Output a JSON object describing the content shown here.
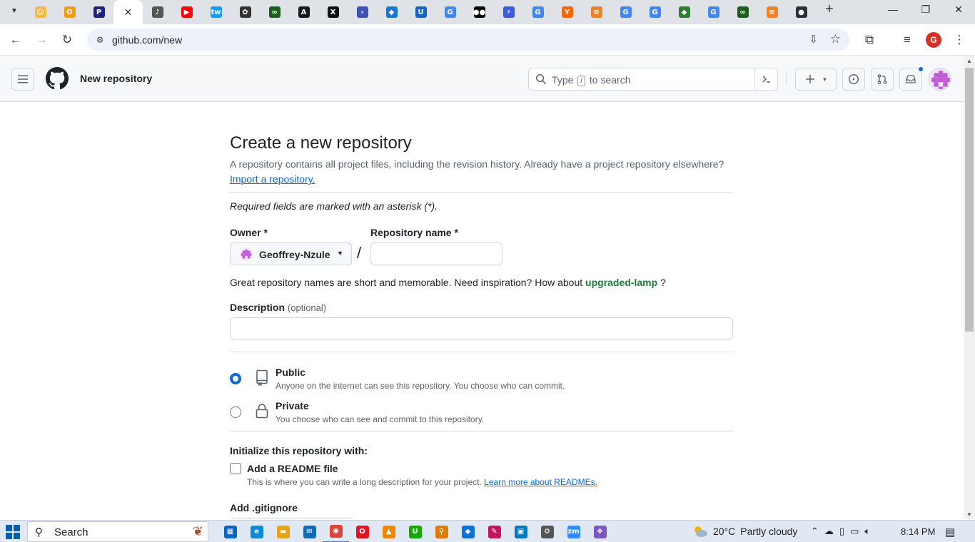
{
  "browser": {
    "url": "github.com/new",
    "pinned_tabs": [
      {
        "name": "tab-emoji",
        "glyph": "☺",
        "color": "#f4b942"
      },
      {
        "name": "tab-orange-badge",
        "glyph": "✪",
        "color": "#f39c12"
      },
      {
        "name": "tab-p-logo",
        "glyph": "P",
        "color": "#1a237e"
      },
      {
        "name": "tab-github-active",
        "glyph": "",
        "color": "#ffffff"
      },
      {
        "name": "tab-audio",
        "glyph": "♪",
        "color": "#555555"
      },
      {
        "name": "tab-youtube",
        "glyph": "▶",
        "color": "#ff0000"
      },
      {
        "name": "tab-tw",
        "glyph": "tw",
        "color": "#1d9bf0"
      },
      {
        "name": "tab-openai",
        "glyph": "✿",
        "color": "#333333"
      },
      {
        "name": "tab-infinity",
        "glyph": "∞",
        "color": "#1b5e20"
      },
      {
        "name": "tab-anthropic",
        "glyph": "A",
        "color": "#191919"
      },
      {
        "name": "tab-x",
        "glyph": "X",
        "color": "#111111"
      },
      {
        "name": "tab-terminal",
        "glyph": "›",
        "color": "#3f51b5"
      },
      {
        "name": "tab-vscode",
        "glyph": "◆",
        "color": "#1976d2"
      },
      {
        "name": "tab-upwork",
        "glyph": "U",
        "color": "#1565c0"
      },
      {
        "name": "tab-google-1",
        "glyph": "G",
        "color": "#4285f4"
      },
      {
        "name": "tab-medium",
        "glyph": "●●",
        "color": "#000000"
      },
      {
        "name": "tab-bolt",
        "glyph": "⚡",
        "color": "#3b5bdb"
      },
      {
        "name": "tab-google-2",
        "glyph": "G",
        "color": "#4285f4"
      },
      {
        "name": "tab-ycombinator",
        "glyph": "Y",
        "color": "#ff6600"
      },
      {
        "name": "tab-stackoverflow-1",
        "glyph": "≡",
        "color": "#f48024"
      },
      {
        "name": "tab-google-3",
        "glyph": "G",
        "color": "#4285f4"
      },
      {
        "name": "tab-google-4",
        "glyph": "G",
        "color": "#4285f4"
      },
      {
        "name": "tab-hashnode",
        "glyph": "◆",
        "color": "#2e7d32"
      },
      {
        "name": "tab-google-5",
        "glyph": "G",
        "color": "#4285f4"
      },
      {
        "name": "tab-infinity-2",
        "glyph": "∞",
        "color": "#1b5e20"
      },
      {
        "name": "tab-stackoverflow-2",
        "glyph": "≡",
        "color": "#f48024"
      },
      {
        "name": "tab-dark-circle",
        "glyph": "●",
        "color": "#263238"
      }
    ],
    "profile_initial": "G"
  },
  "header": {
    "title": "New repository",
    "search_prefix": "Type",
    "search_key": "/",
    "search_suffix": "to search"
  },
  "form": {
    "title": "Create a new repository",
    "subtitle": "A repository contains all project files, including the revision history. Already have a project repository elsewhere?",
    "import_link": "Import a repository.",
    "required_note": "Required fields are marked with an asterisk (*).",
    "owner_label": "Owner *",
    "owner_value": "Geoffrey-Nzule",
    "repo_name_label": "Repository name *",
    "repo_name_value": "",
    "hint_prefix": "Great repository names are short and memorable. Need inspiration? How about",
    "hint_suggestion": "upgraded-lamp",
    "hint_suffix": "?",
    "description_label": "Description",
    "description_optional": "(optional)",
    "description_value": "",
    "visibility": [
      {
        "title": "Public",
        "desc": "Anyone on the internet can see this repository. You choose who can commit.",
        "checked": true
      },
      {
        "title": "Private",
        "desc": "You choose who can see and commit to this repository.",
        "checked": false
      }
    ],
    "init_label": "Initialize this repository with:",
    "readme_label": "Add a README file",
    "readme_checked": false,
    "readme_desc": "This is where you can write a long description for your project.",
    "readme_link": "Learn more about READMEs.",
    "gitignore_label": "Add .gitignore"
  },
  "taskbar": {
    "search_placeholder": "Search",
    "apps": [
      {
        "name": "taskbar-app-store",
        "glyph": "▦",
        "color": "#0a64c8"
      },
      {
        "name": "taskbar-app-edge",
        "glyph": "e",
        "color": "#0f8bd6"
      },
      {
        "name": "taskbar-app-file-explorer",
        "glyph": "▬",
        "color": "#e8a317"
      },
      {
        "name": "taskbar-app-mail",
        "glyph": "✉",
        "color": "#0f6cbd"
      },
      {
        "name": "taskbar-app-chrome",
        "glyph": "◉",
        "color": "#db4437"
      },
      {
        "name": "taskbar-app-opera",
        "glyph": "O",
        "color": "#e0141e"
      },
      {
        "name": "taskbar-app-vlc",
        "glyph": "▲",
        "color": "#f28500"
      },
      {
        "name": "taskbar-app-upwork",
        "glyph": "U",
        "color": "#14a800"
      },
      {
        "name": "taskbar-app-search-tool",
        "glyph": "⚲",
        "color": "#e07b00"
      },
      {
        "name": "taskbar-app-vscode",
        "glyph": "◆",
        "color": "#0a74d4"
      },
      {
        "name": "taskbar-app-paint",
        "glyph": "✎",
        "color": "#c2185b"
      },
      {
        "name": "taskbar-app-screen",
        "glyph": "▣",
        "color": "#0277bd"
      },
      {
        "name": "taskbar-app-settings",
        "glyph": "⚙",
        "color": "#555555"
      },
      {
        "name": "taskbar-app-zoom",
        "glyph": "zm",
        "color": "#2d8cff"
      },
      {
        "name": "taskbar-app-colorful",
        "glyph": "❖",
        "color": "#7e57c2"
      }
    ],
    "weather_temp": "20°C",
    "weather_desc": "Partly cloudy",
    "time": "8:14 PM"
  }
}
